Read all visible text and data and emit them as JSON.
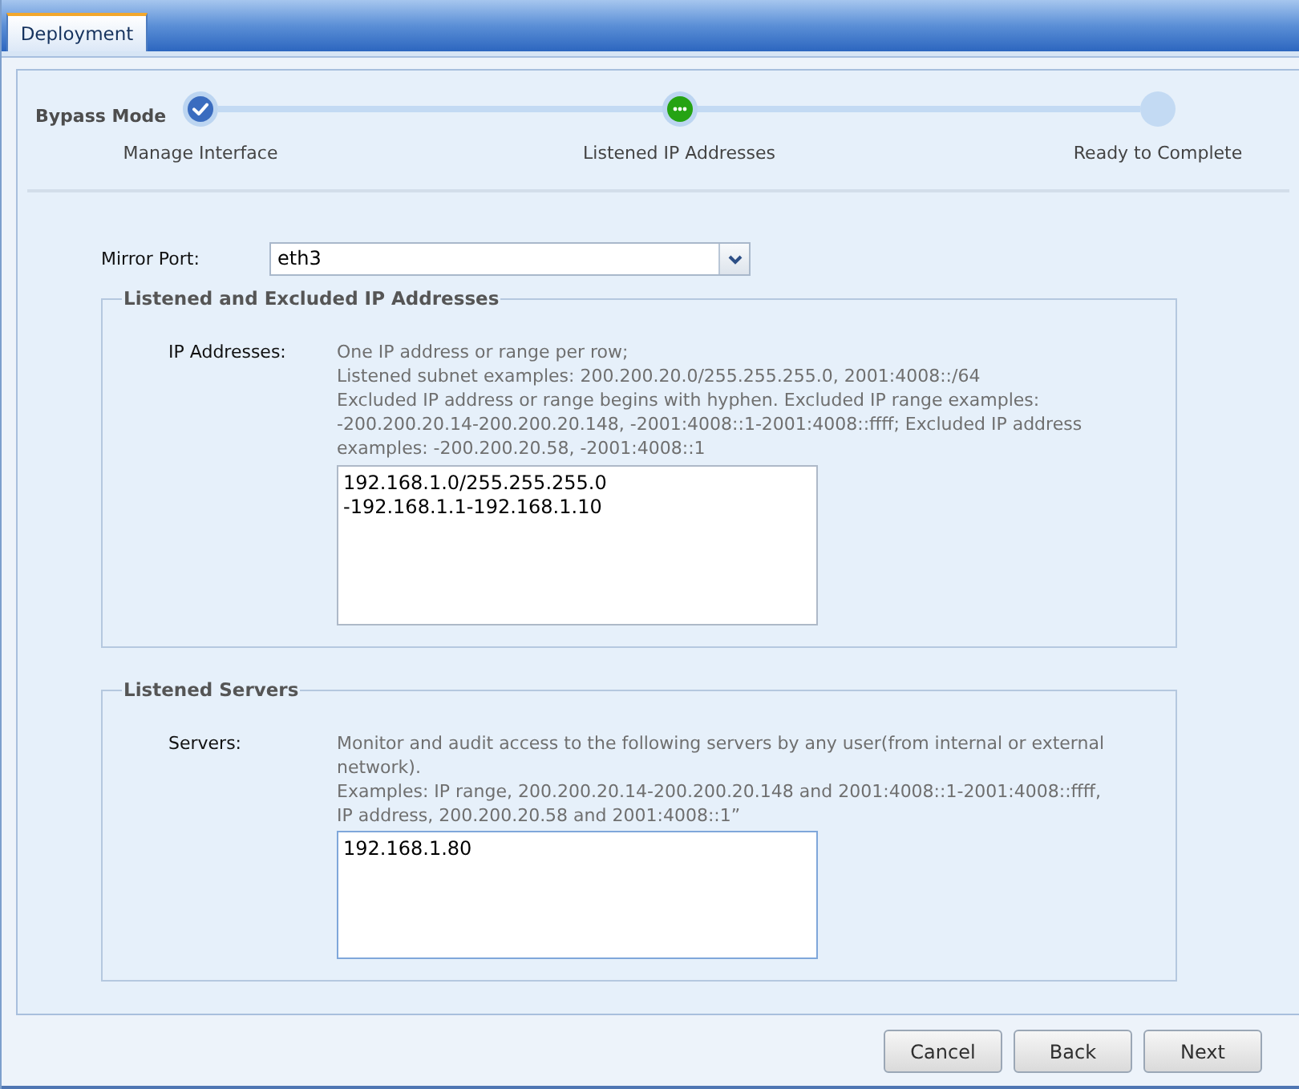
{
  "tabs": [
    {
      "label": "Deployment",
      "selected": true
    }
  ],
  "wizard": {
    "title": "Bypass Mode",
    "steps": [
      {
        "label": "Manage Interface",
        "completed": true,
        "selected": false
      },
      {
        "label": "Listened IP Addresses",
        "completed": false,
        "selected": true
      },
      {
        "label": "Ready to Complete",
        "completed": false,
        "selected": false
      }
    ]
  },
  "mirror_port": {
    "label": "Mirror Port:",
    "value": "eth3"
  },
  "sections": [
    {
      "legend": "Listened and Excluded IP Addresses",
      "label": "IP Addresses:",
      "hint": [
        "One IP address or range per row;",
        "Listened subnet examples: 200.200.20.0/255.255.255.0, 2001:4008::/64",
        "Excluded IP address or range begins with hyphen. Excluded IP range examples: -200.200.20.14-200.200.20.148, -2001:4008::1-2001:4008::ffff; Excluded IP address examples: -200.200.20.58, -2001:4008::1"
      ],
      "value": [
        "192.168.1.0/255.255.255.0",
        "-192.168.1.1-192.168.1.10"
      ],
      "focused": false
    },
    {
      "legend": "Listened Servers",
      "label": "Servers:",
      "hint": [
        "Monitor and audit access to the following servers by any user(from internal or external network).",
        "Examples: IP range, 200.200.20.14-200.200.20.148 and 2001:4008::1-2001:4008::ffff, IP address, 200.200.20.58 and 2001:4008::1”"
      ],
      "value": [
        "192.168.1.80"
      ],
      "focused": true
    }
  ],
  "buttons": [
    "Cancel",
    "Back",
    "Next"
  ]
}
